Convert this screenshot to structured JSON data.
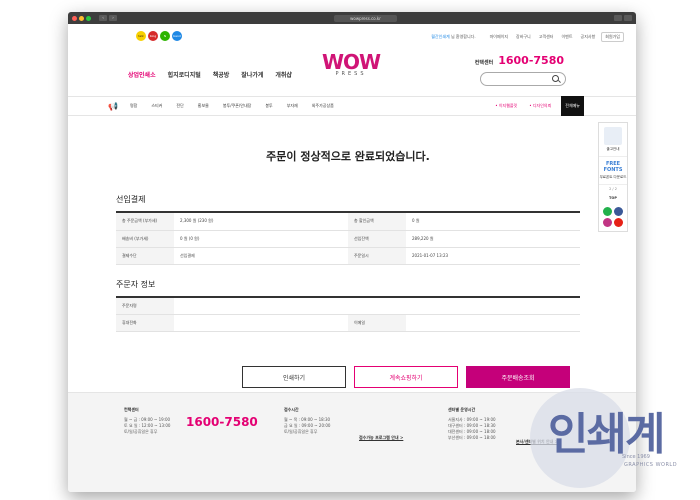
{
  "browser": {
    "url": "wowpress.co.kr"
  },
  "topbar": {
    "sns": [
      {
        "icon": "kakao-icon",
        "label": "talk",
        "color": "#f7d000"
      },
      {
        "icon": "naver-blog-icon",
        "label": "blog",
        "color": "#d62b2b"
      },
      {
        "icon": "naver-icon",
        "label": "N",
        "color": "#2db400"
      },
      {
        "icon": "band-icon",
        "label": "band",
        "color": "#1e88e5"
      }
    ],
    "notice_prefix": "월간인쇄계",
    "notice_suffix": "님 환영합니다.",
    "links": [
      "마이페이지",
      "장바구니",
      "고객센터",
      "이벤트",
      "공지사항"
    ],
    "join_label": "회원가입"
  },
  "header": {
    "nav": [
      {
        "label": "상업인쇄소",
        "highlight": true
      },
      {
        "label": "힙지로디지털",
        "highlight": false
      },
      {
        "label": "책공방",
        "highlight": false
      },
      {
        "label": "잘나가게",
        "highlight": false
      },
      {
        "label": "개취샵",
        "highlight": false
      }
    ],
    "logo_big": "WOW",
    "logo_small": "PRESS",
    "contact_label": "컨택센터",
    "contact_phone": "1600-7580"
  },
  "catnav": {
    "items": [
      "명함",
      "스티커",
      "전단",
      "홍보물",
      "봉투/쿠폰/안내장",
      "봉투",
      "부자재",
      "외주가공상품"
    ],
    "specials": [
      "• 이지웹플릿",
      "• 디자인의뢰"
    ],
    "all_label": "전체메뉴"
  },
  "quickbar": {
    "guide_label": "출고안내",
    "free_line1": "FREE",
    "free_line2": "FONTS",
    "free_label": "무료폰트 다운로드",
    "page": "2 / 2",
    "top_label": "TOP",
    "sns": [
      {
        "icon": "line-icon",
        "color": "#22b14c"
      },
      {
        "icon": "facebook-icon",
        "color": "#3b5998"
      },
      {
        "icon": "instagram-icon",
        "color": "#c13584"
      },
      {
        "icon": "youtube-icon",
        "color": "#e62117"
      }
    ]
  },
  "content": {
    "complete_title": "주문이 정상적으로 완료되었습니다.",
    "payment": {
      "title": "선입결제",
      "rows": [
        [
          "총 주문금액 (부가세)",
          "2,300 원 (230 원)",
          "총 할인금액",
          "0 원"
        ],
        [
          "배송비 (부가세)",
          "0 원 (0 원)",
          "선입잔액",
          "289,220 원"
        ],
        [
          "결제수단",
          "선입결제",
          "주문일시",
          "2021-01-07 13:23"
        ]
      ]
    },
    "orderer": {
      "title": "주문자 정보",
      "rows": [
        [
          "주문자명",
          "",
          "",
          ""
        ],
        [
          "휴대전화",
          "",
          "이메일",
          ""
        ]
      ]
    },
    "buttons": {
      "print": "인쇄하기",
      "continue": "계속쇼핑하기",
      "track": "주문배송조회"
    }
  },
  "footer": {
    "contact_title": "컨택센터",
    "contact_lines": [
      "월 ~ 금 : 09:00 ~ 19:00",
      "토  요  일 : 12:00 ~ 13:00",
      "토/일/공휴일은 휴무"
    ],
    "phone": "1600-7580",
    "hours_title": "접수시간",
    "hours_lines": [
      "월 ~ 목 : 09:00 ~ 18:30",
      "금 요 일 : 09:00 ~ 20:00",
      "토/일/공휴일은 휴무"
    ],
    "hours_link": "접수가능 프로그램 안내 >",
    "center_title": "센터별 운영시간",
    "center_lines": [
      "서울지사 : 09:00 ~ 19:00",
      "대구센터 : 09:00 ~ 18:30",
      "대전센터 : 09:00 ~ 18:00",
      "부산센터 : 09:00 ~ 18:00"
    ],
    "center_link": "본사/센터별 위치 안내 >"
  },
  "watermark": {
    "text": "인쇄계",
    "since": "Since 1969",
    "brand": "GRAPHICS WORLD"
  }
}
